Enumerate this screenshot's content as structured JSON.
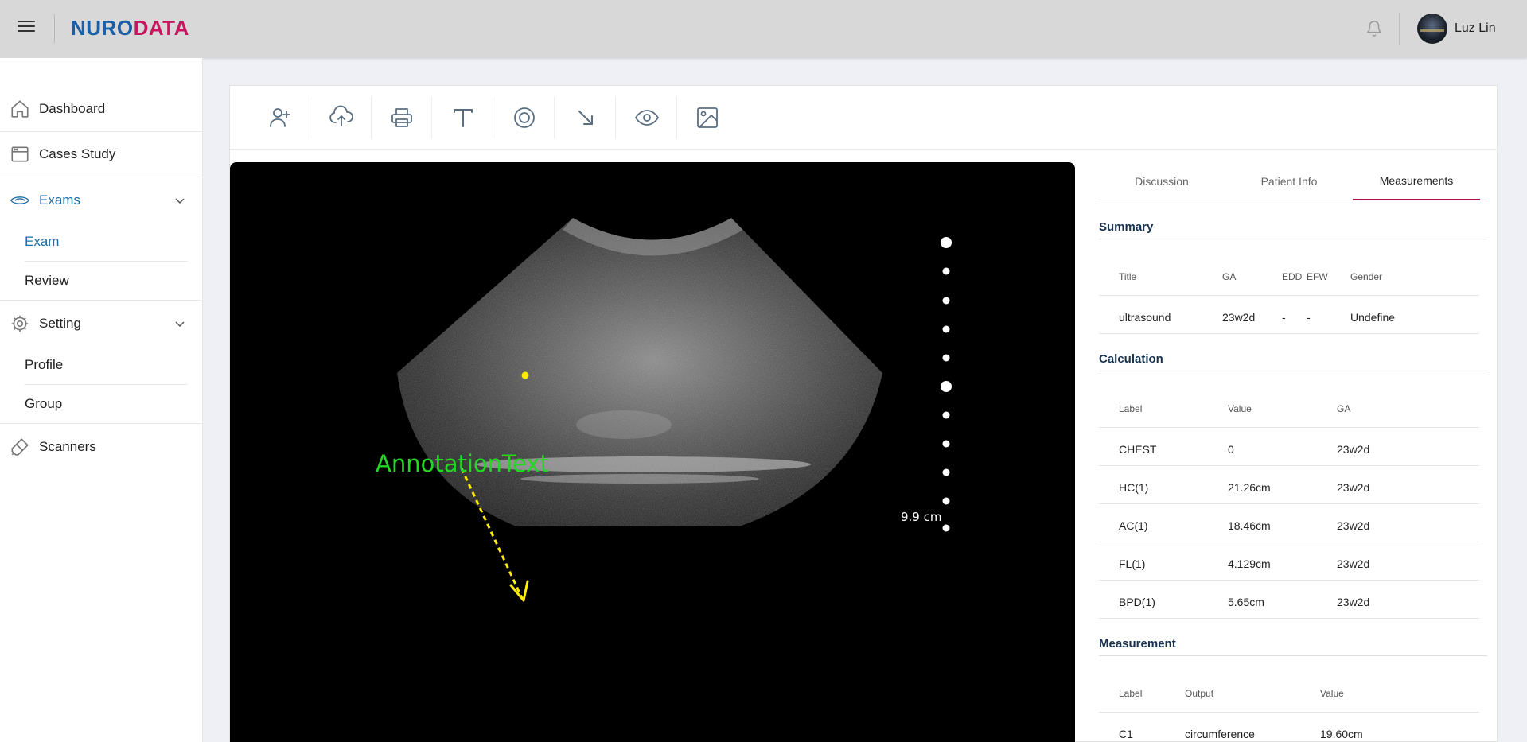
{
  "header": {
    "logo_part1": "NURO",
    "logo_part2": "DATA",
    "user_name": "Luz Lin"
  },
  "sidebar": {
    "items": [
      {
        "label": "Dashboard"
      },
      {
        "label": "Cases Study"
      },
      {
        "label": "Exams"
      },
      {
        "label": "Setting"
      },
      {
        "label": "Scanners"
      }
    ],
    "exams_sub": [
      {
        "label": "Exam"
      },
      {
        "label": "Review"
      }
    ],
    "setting_sub": [
      {
        "label": "Profile"
      },
      {
        "label": "Group"
      }
    ]
  },
  "toolbar": {
    "tools": [
      "add-patient-icon",
      "upload-cloud-icon",
      "printer-icon",
      "text-tool-icon",
      "circle-tool-icon",
      "arrow-tool-icon",
      "eye-icon",
      "image-icon"
    ]
  },
  "viewer": {
    "annotation_text": "AnnotationText",
    "scale_label": "9.9 cm"
  },
  "tabs": [
    {
      "label": "Discussion"
    },
    {
      "label": "Patient Info"
    },
    {
      "label": "Measurements"
    }
  ],
  "summary": {
    "title": "Summary",
    "headers": [
      "Title",
      "GA",
      "EDD",
      "EFW",
      "Gender"
    ],
    "row": [
      "ultrasound",
      "23w2d",
      "-",
      "-",
      "Undefine"
    ]
  },
  "calculation": {
    "title": "Calculation",
    "headers": [
      "Label",
      "Value",
      "GA"
    ],
    "rows": [
      [
        "CHEST",
        "0",
        "23w2d"
      ],
      [
        "HC(1)",
        "21.26cm",
        "23w2d"
      ],
      [
        "AC(1)",
        "18.46cm",
        "23w2d"
      ],
      [
        "FL(1)",
        "4.129cm",
        "23w2d"
      ],
      [
        "BPD(1)",
        "5.65cm",
        "23w2d"
      ]
    ]
  },
  "measurement": {
    "title": "Measurement",
    "headers": [
      "Label",
      "Output",
      "Value"
    ],
    "rows": [
      [
        "C1",
        "circumference",
        "19.60cm"
      ]
    ]
  },
  "colors": {
    "accent_blue": "#1a6fa8",
    "accent_pink": "#b0124f",
    "annotation_green": "#22d822",
    "annotation_yellow": "#ffee00"
  }
}
